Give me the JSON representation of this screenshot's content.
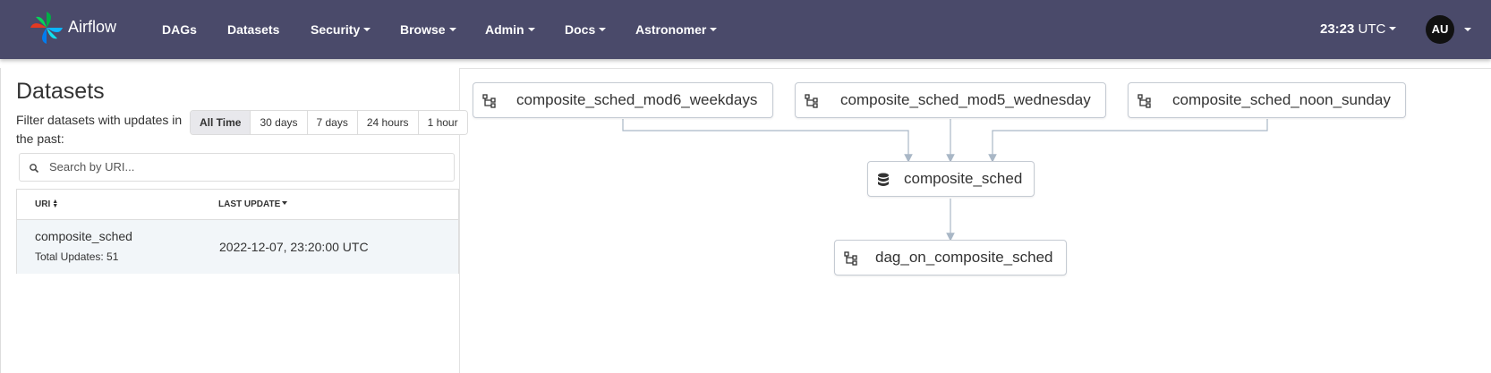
{
  "nav": {
    "brand": "Airflow",
    "items": [
      {
        "label": "DAGs",
        "dropdown": false
      },
      {
        "label": "Datasets",
        "dropdown": false
      },
      {
        "label": "Security",
        "dropdown": true
      },
      {
        "label": "Browse",
        "dropdown": true
      },
      {
        "label": "Admin",
        "dropdown": true
      },
      {
        "label": "Docs",
        "dropdown": true
      },
      {
        "label": "Astronomer",
        "dropdown": true
      }
    ],
    "clock_time": "23:23",
    "clock_tz": "UTC",
    "avatar_initials": "AU"
  },
  "datasets": {
    "title": "Datasets",
    "filter_text": "Filter datasets with updates in the past:",
    "time_filters": [
      "All Time",
      "30 days",
      "7 days",
      "24 hours",
      "1 hour"
    ],
    "active_filter": "All Time",
    "search_placeholder": "Search by URI...",
    "columns": {
      "uri": "URI",
      "last_update": "LAST UPDATE"
    },
    "rows": [
      {
        "uri": "composite_sched",
        "total_updates": "Total Updates: 51",
        "last_update": "2022-12-07, 23:20:00 UTC"
      }
    ]
  },
  "graph": {
    "nodes": [
      {
        "label": "composite_sched_mod6_weekdays",
        "kind": "dag"
      },
      {
        "label": "composite_sched_mod5_wednesday",
        "kind": "dag"
      },
      {
        "label": "composite_sched_noon_sunday",
        "kind": "dag"
      },
      {
        "label": "composite_sched",
        "kind": "dataset"
      },
      {
        "label": "dag_on_composite_sched",
        "kind": "dag"
      }
    ]
  },
  "colors": {
    "navbar": "#4a4a6a",
    "edge": "#a9b7c6",
    "node_border": "#c5cbd3",
    "row_bg": "#f2f6f9"
  }
}
